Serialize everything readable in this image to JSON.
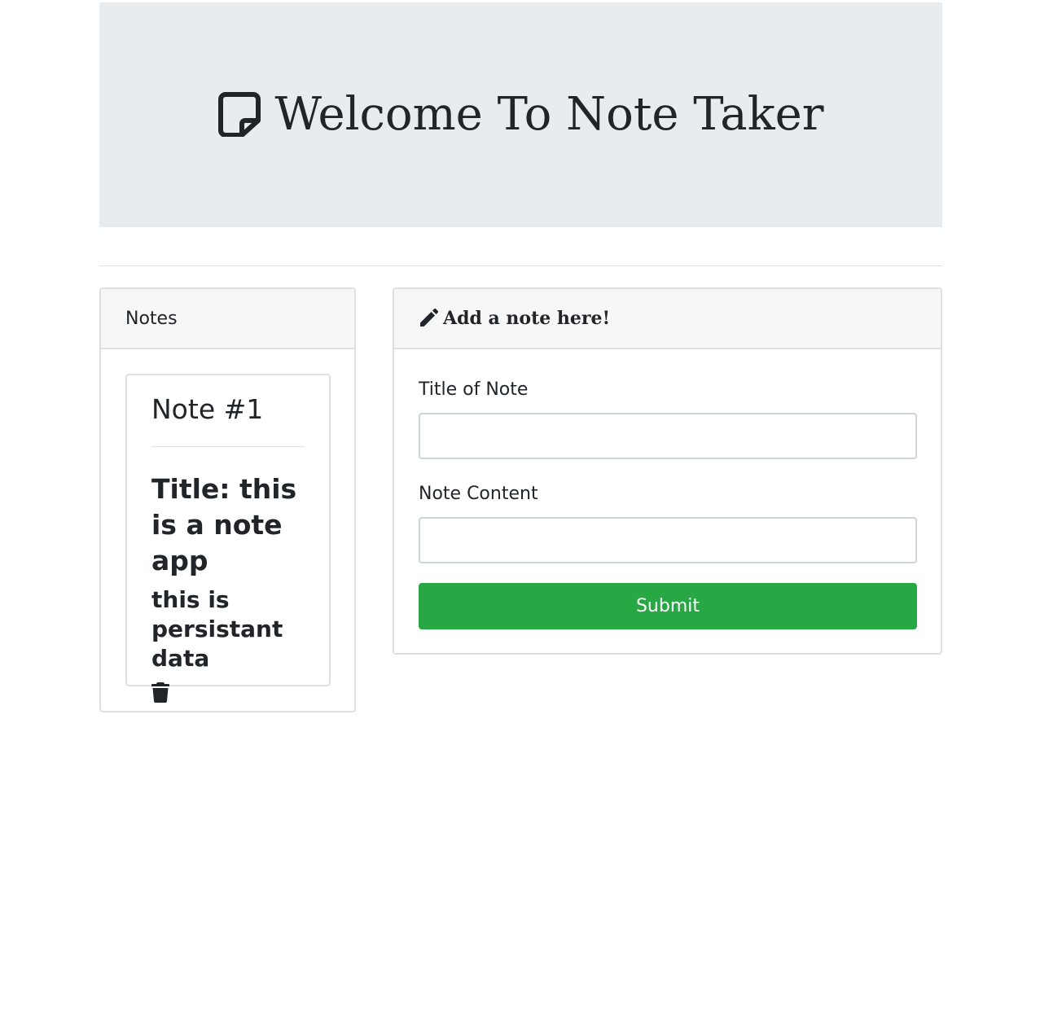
{
  "header": {
    "title": "Welcome To Note Taker",
    "icon": "sticky-note-icon"
  },
  "notes_panel": {
    "header_label": "Notes",
    "notes": [
      {
        "heading": "Note #1",
        "title": "Title: this is a note app",
        "body": "this is persistant data",
        "delete_icon": "trash-icon"
      }
    ]
  },
  "form_panel": {
    "header_label": "Add a note here!",
    "header_icon": "pencil-icon",
    "title_label": "Title of Note",
    "title_value": "",
    "content_label": "Note Content",
    "content_value": "",
    "submit_label": "Submit"
  },
  "colors": {
    "jumbotron_bg": "#e9ecef",
    "submit_bg": "#28a745",
    "card_header_bg": "#f7f7f7"
  }
}
